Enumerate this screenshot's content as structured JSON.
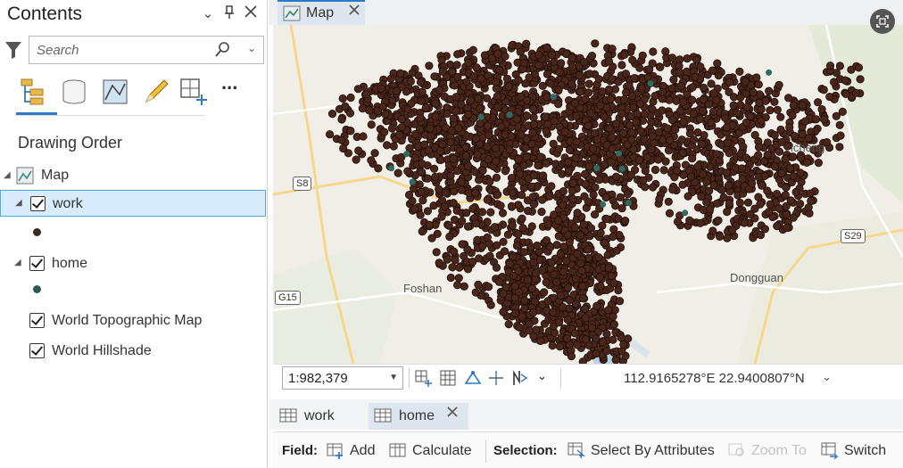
{
  "contents_pane": {
    "title": "Contents",
    "controls": [
      "chevron-down-icon",
      "pin-icon",
      "close-icon"
    ],
    "search": {
      "placeholder": "Search"
    },
    "tools": [
      "list-by-drawing-order-icon",
      "list-by-data-source-icon",
      "list-by-snapping-icon",
      "list-by-editing-icon",
      "list-by-selection-icon",
      "more-icon"
    ],
    "more_label": "...",
    "section_heading": "Drawing Order",
    "tree": {
      "map_label": "Map",
      "layers": [
        {
          "label": "work",
          "checked": true,
          "selected": true,
          "symbol_color": "#3b2a22"
        },
        {
          "label": "home",
          "checked": true,
          "selected": false,
          "symbol_color": "#2d5a55"
        },
        {
          "label": "World Topographic Map",
          "checked": true,
          "selected": false
        },
        {
          "label": "World Hillshade",
          "checked": true,
          "selected": false
        }
      ]
    }
  },
  "map_view": {
    "tab_label": "Map",
    "place_labels": [
      "Foshan",
      "Dongguan",
      "icheng"
    ],
    "road_shields": [
      "S8",
      "S29",
      "G15"
    ],
    "point_color": "#4a2519",
    "point_stroke": "#1e0f0a",
    "home_point_color": "#2f6a63"
  },
  "status_bar": {
    "scale": "1:982,379",
    "coordinates": "112.9165278°E 22.9400807°N"
  },
  "table_tabs": [
    {
      "label": "work",
      "active": false
    },
    {
      "label": "home",
      "active": true
    }
  ],
  "table_toolbar": {
    "field_label": "Field:",
    "add_label": "Add",
    "calculate_label": "Calculate",
    "selection_label": "Selection:",
    "select_by_attributes_label": "Select By Attributes",
    "zoom_to_label": "Zoom To",
    "switch_label": "Switch"
  }
}
